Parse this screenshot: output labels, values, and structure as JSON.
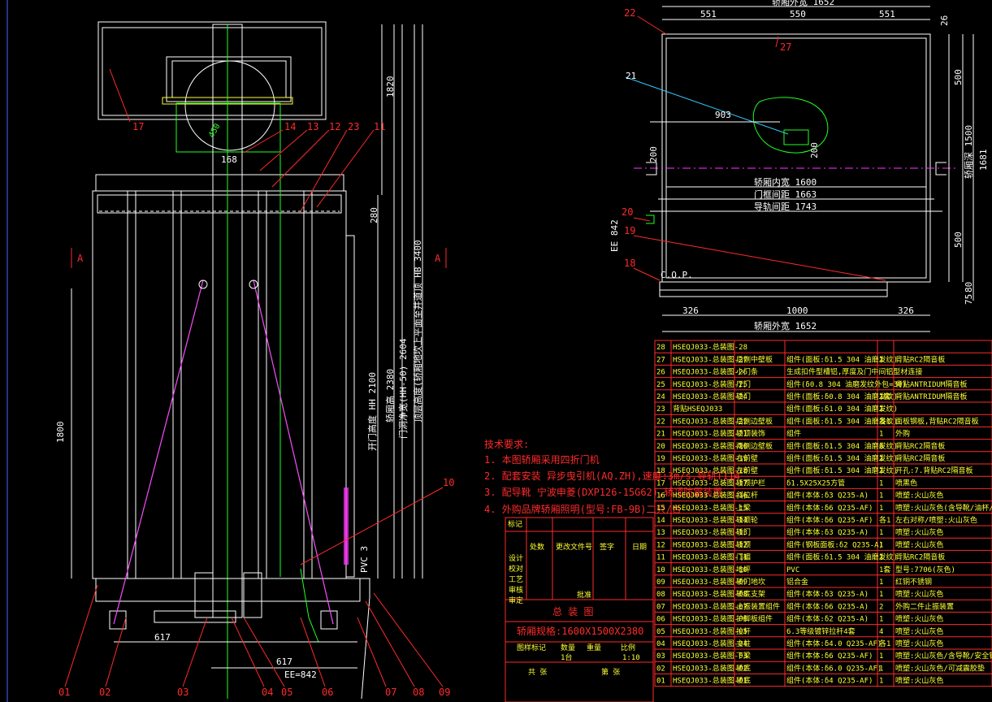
{
  "colors": {
    "background": "#000000",
    "label": "#ff2a2a",
    "dimension": "#ffffff",
    "table_text": "#ffff33",
    "table_grid": "#ff2a2a",
    "rail": "#22ff22",
    "door": "#ff33ff"
  },
  "front_view": {
    "callouts_top": [
      "17",
      "14",
      "13",
      "12",
      "23",
      "11"
    ],
    "callouts_bottom": [
      "01",
      "02",
      "03",
      "04",
      "05",
      "06",
      "07",
      "08",
      "09"
    ],
    "callout_10": "10",
    "section_marks": [
      "A",
      "A"
    ],
    "dims": {
      "d1820": "1820",
      "d1800": "1800",
      "d280": "280",
      "d617a": "617",
      "d617b": "617",
      "d168": "168",
      "pvc": "PVC 3",
      "ee": "EE=842",
      "v1": "开门高度 HH 2100",
      "v2": "轿厢高 2380",
      "v3": "门洞净宽(HH-50) 2604",
      "v4": "顶层高度(轿厢地坎上平面至井道顶 HB 3400",
      "ang": "450"
    }
  },
  "plan_view": {
    "callouts": [
      "22",
      "27",
      "21",
      "20",
      "19",
      "18"
    ],
    "cop": "C.O.P.",
    "dims": {
      "top_total": "轿厢外宽 1652",
      "top_a": "551",
      "top_b": "550",
      "top_c": "551",
      "right_26": "26",
      "right_500a": "500",
      "right_500b": "500",
      "right_1500": "轿厢深 1500",
      "right_1681": "1681",
      "right_75": "75",
      "right_80": "80",
      "d903": "903",
      "d200a": "200",
      "d200b": "200",
      "inner_w": "轿厢内宽 1600",
      "guide_1663": "门框间距 1663",
      "guide_1743": "导轨间距 1743",
      "ee_842": "EE 842",
      "bot_a": "326",
      "bot_b": "1000",
      "bot_c": "326",
      "bot_total": "轿厢外宽 1652"
    }
  },
  "tech_notes": {
    "title": "技术要求:",
    "items": [
      "1. 本图轿厢采用四折门机",
      "2. 配套安装 异步曳引机(AQ.ZH),速度:3m/s,导轨T114",
      "3. 配导靴 宁波申菱(DXP126-15G62),轿顶防震装置",
      "4. 外购品牌轿厢照明(型号:FB-9B)二只/台"
    ]
  },
  "title_block": {
    "rev_headers": [
      "标记",
      "处数",
      "更改文件号",
      "签字",
      "日期"
    ],
    "roles": [
      "设计",
      "校对",
      "工艺",
      "审核",
      "审定"
    ],
    "approve": "批准",
    "drawing_name": "总 装 图",
    "spec": "轿厢规格:1600X1500X2380",
    "stage_headers": [
      "图样标记",
      "数量",
      "重量",
      "比例"
    ],
    "scale": "1:10",
    "qty": "1台",
    "sheet": "共   张",
    "sheet_of": "第   张"
  },
  "bom": [
    {
      "no": "28",
      "code": "HSEQJ033-总装图-28",
      "name": "",
      "spec": "",
      "qty": "",
      "note": ""
    },
    {
      "no": "27",
      "code": "HSEQJ033-总装图-27",
      "name": "后侧中壁板",
      "spec": "组件(面板:δ1.5 304 油磨发纹)",
      "qty": "1",
      "note": "背贴RC2隔音板"
    },
    {
      "no": "26",
      "code": "HSEQJ033-总装图-26",
      "name": "小门条",
      "spec": "生成扣件型槽铝,厚度及门中间铝型材连接",
      "qty": "",
      "note": ""
    },
    {
      "no": "25",
      "code": "HSEQJ033-总装图-25",
      "name": "厅门",
      "spec": "组件(δ0.8 304 油磨发纹外包=30)",
      "qty": "",
      "note": "背贴ANTRIDUM隔音板"
    },
    {
      "no": "24",
      "code": "HSEQJ033-总装图-24",
      "name": "轿门",
      "spec": "组件(面板:δ0.8 304 油磨发纹)",
      "qty": "1套",
      "note": "背贴ANTRIDUM隔音板"
    },
    {
      "no": "23",
      "code": "背贴HSEQJ033",
      "name": "",
      "spec": "组件(面板:δ1.0 304 油磨发纹)",
      "qty": "1",
      "note": ""
    },
    {
      "no": "22",
      "code": "HSEQJ033-总装图-22",
      "name": "后侧边壁板",
      "spec": "组件(面板:δ1.5 304 油磨发纹)",
      "qty": "各1",
      "note": "面板钢板,背贴RC2隔音板"
    },
    {
      "no": "21",
      "code": "HSEQJ033-总装图-21",
      "name": "轿顶装饰",
      "spec": "组件",
      "qty": "1",
      "note": "外购"
    },
    {
      "no": "20",
      "code": "HSEQJ033-总装图-20",
      "name": "两侧边壁板",
      "spec": "组件(面板:δ1.5 304 油磨发纹)",
      "qty": "6",
      "note": "背贴RC2隔音板"
    },
    {
      "no": "19",
      "code": "HSEQJ033-总装图-19",
      "name": "右前壁",
      "spec": "组件(面板:δ1.5 304 油磨发纹)",
      "qty": "1",
      "note": "背贴RC2隔音板"
    },
    {
      "no": "18",
      "code": "HSEQJ033-总装图-18",
      "name": "左前壁",
      "spec": "组件(面板:δ1.5 304 油磨发纹)",
      "qty": "1",
      "note": "开孔:7.背贴RC2隔音板"
    },
    {
      "no": "17",
      "code": "HSEQJ033-总装图-17",
      "name": "轿顶护栏",
      "spec": "δ1.5X25X25方管",
      "qty": "1",
      "note": "喷黑色"
    },
    {
      "no": "16",
      "code": "HSEQJ033-总装图-16",
      "name": "斜拉杆",
      "spec": "组件(本体:δ3 Q235-A)",
      "qty": "1",
      "note": "喷塑:火山灰色"
    },
    {
      "no": "15",
      "code": "HSEQJ033-总装图-15",
      "name": "上梁",
      "spec": "组件(本体:δ6 Q235-AF)",
      "qty": "1",
      "note": "喷塑:火山灰色(含导靴/油杯/)"
    },
    {
      "no": "14",
      "code": "HSEQJ033-总装图-14",
      "name": "轿顶轮",
      "spec": "组件(本体:δ6 Q235-AF)",
      "qty": "各1",
      "note": "左右对称/喷塑:火山灰色"
    },
    {
      "no": "13",
      "code": "HSEQJ033-总装图-13",
      "name": "轿门",
      "spec": "组件(本体:δ3 Q235-A)",
      "qty": "1",
      "note": "喷塑:火山灰色"
    },
    {
      "no": "12",
      "code": "HSEQJ033-总装图-12",
      "name": "轿顶",
      "spec": "组件(钢板面板:δ2 Q235-A)",
      "qty": "1",
      "note": "喷塑:火山灰色"
    },
    {
      "no": "11",
      "code": "HSEQJ033-总装图-11",
      "name": "门楣",
      "spec": "组件(面板:δ1.5 304 油磨发纹)",
      "qty": "1",
      "note": "背贴RC2隔音板"
    },
    {
      "no": "10",
      "code": "HSEQJ033-总装图-10",
      "name": "地坪",
      "spec": "PVC",
      "qty": "1套",
      "note": "型号:7706(灰色)"
    },
    {
      "no": "09",
      "code": "HSEQJ033-总装图-09",
      "name": "轿门地坎",
      "spec": "铝合金",
      "qty": "1",
      "note": "红铜不锈钢"
    },
    {
      "no": "08",
      "code": "HSEQJ033-总装图-08",
      "name": "轿底支架",
      "spec": "组件(本体:δ3 Q235-A)",
      "qty": "1",
      "note": "喷塑:火山灰色"
    },
    {
      "no": "07",
      "code": "HSEQJ033-总装图-07",
      "name": "止振装置组件",
      "spec": "组件(本体:δ6 Q235-A)",
      "qty": "2",
      "note": "外购二件止振装置"
    },
    {
      "no": "06",
      "code": "HSEQJ033-总装图-06",
      "name": "护脚板组件",
      "spec": "组件(本体:δ2 Q235-A)",
      "qty": "1",
      "note": "喷塑:火山灰色"
    },
    {
      "no": "05",
      "code": "HSEQJ033-总装图-05",
      "name": "拉杆",
      "spec": "6.3等级镀锌拉杆4套",
      "qty": "4",
      "note": "喷塑:火山灰色"
    },
    {
      "no": "04",
      "code": "HSEQJ033-总装图-04",
      "name": "立柱",
      "spec": "组件(本体:δ4.0 Q235-AF)",
      "qty": "各1",
      "note": "喷塑:火山灰色"
    },
    {
      "no": "03",
      "code": "HSEQJ033-总装图-03",
      "name": "下梁",
      "spec": "组件(本体:δ6 Q235-AF)",
      "qty": "1",
      "note": "喷塑:火山灰色/含导靴/安全钳/导轨/"
    },
    {
      "no": "02",
      "code": "HSEQJ033-总装图-02",
      "name": "轿底",
      "spec": "组件(本体:δ6.0 Q235-AF)",
      "qty": "1",
      "note": "喷塑:火山灰色/可减震胶垫"
    },
    {
      "no": "01",
      "code": "HSEQJ033-总装图-01",
      "name": "轿底",
      "spec": "组件(本体:δ4 Q235-AF)",
      "qty": "1",
      "note": "喷塑:火山灰色"
    }
  ]
}
